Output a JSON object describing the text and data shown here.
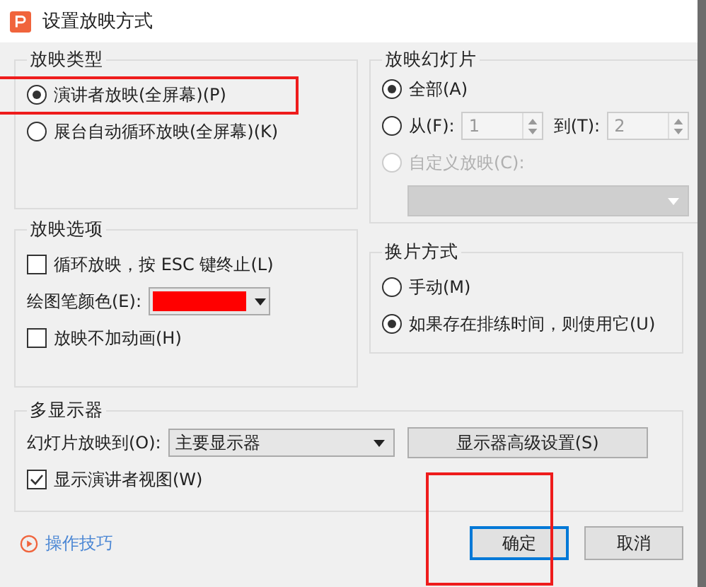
{
  "window": {
    "title": "设置放映方式"
  },
  "show_type": {
    "title": "放映类型",
    "options": [
      {
        "label": "演讲者放映(全屏幕)(P)",
        "selected": true
      },
      {
        "label": "展台自动循环放映(全屏幕)(K)",
        "selected": false
      }
    ]
  },
  "slides": {
    "title": "放映幻灯片",
    "options": [
      {
        "kind": "plain",
        "label": "全部(A)",
        "selected": true,
        "disabled": false
      },
      {
        "kind": "range",
        "label": "从(F):",
        "from": "1",
        "to_label": "到(T):",
        "to": "2",
        "selected": false,
        "disabled": false
      },
      {
        "kind": "custom",
        "label": "自定义放映(C):",
        "selected": false,
        "disabled": true
      }
    ]
  },
  "show_options": {
    "title": "放映选项",
    "items": [
      {
        "kind": "checkbox",
        "label": "循环放映，按 ESC 键终止(L)",
        "checked": false
      },
      {
        "kind": "color",
        "label": "绘图笔颜色(E):",
        "color": "#ff0000"
      },
      {
        "kind": "checkbox",
        "label": "放映不加动画(H)",
        "checked": false
      }
    ]
  },
  "advance": {
    "title": "换片方式",
    "options": [
      {
        "label": "手动(M)",
        "selected": false
      },
      {
        "label": "如果存在排练时间，则使用它(U)",
        "selected": true
      }
    ]
  },
  "monitors": {
    "title": "多显示器",
    "target_label": "幻灯片放映到(O):",
    "target_value": "主要显示器",
    "advanced_button": "显示器高级设置(S)",
    "presenter_view": {
      "label": "显示演讲者视图(W)",
      "checked": true
    }
  },
  "tips_link": "操作技巧",
  "buttons": [
    {
      "label": "确定",
      "default": true
    },
    {
      "label": "取消",
      "default": false
    }
  ]
}
